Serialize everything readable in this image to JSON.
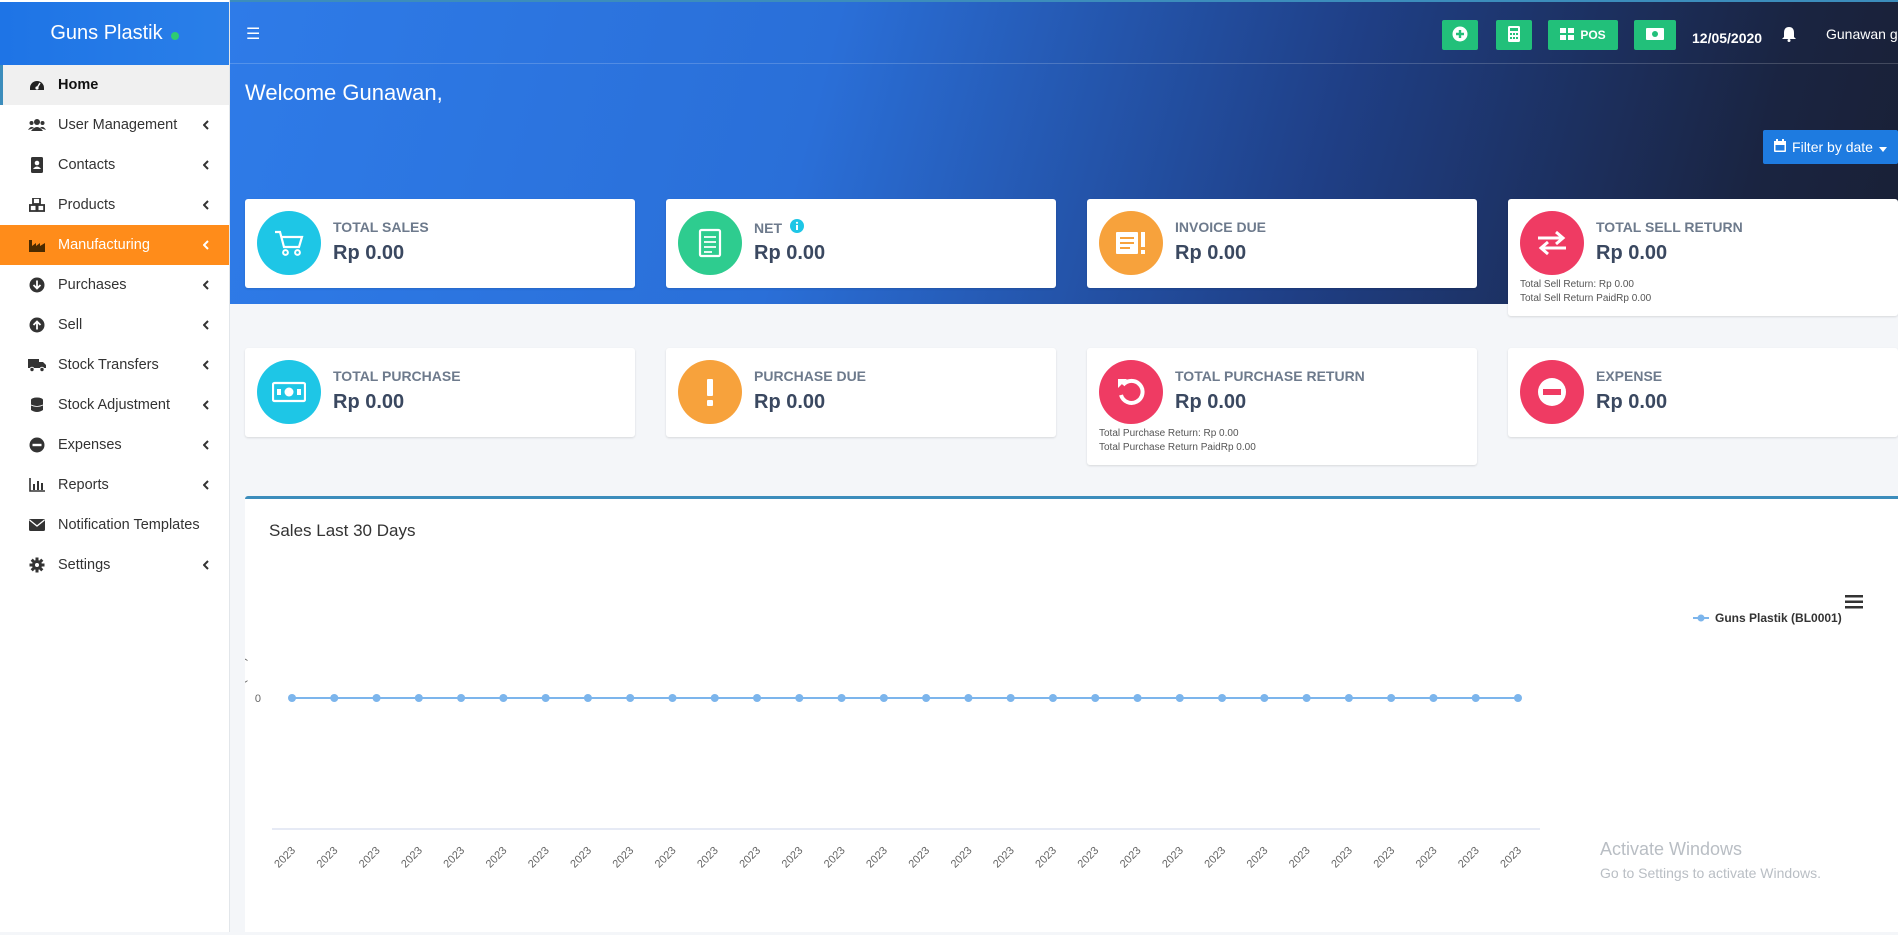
{
  "brand": {
    "name": "Guns Plastik"
  },
  "sidebar": {
    "items": [
      {
        "label": "Home",
        "icon": "dashboard-icon"
      },
      {
        "label": "User Management",
        "icon": "users-icon"
      },
      {
        "label": "Contacts",
        "icon": "address-book-icon"
      },
      {
        "label": "Products",
        "icon": "cubes-icon"
      },
      {
        "label": "Manufacturing",
        "icon": "industry-icon"
      },
      {
        "label": "Purchases",
        "icon": "arrow-circle-down-icon"
      },
      {
        "label": "Sell",
        "icon": "arrow-circle-up-icon"
      },
      {
        "label": "Stock Transfers",
        "icon": "truck-icon"
      },
      {
        "label": "Stock Adjustment",
        "icon": "database-icon"
      },
      {
        "label": "Expenses",
        "icon": "minus-circle-icon"
      },
      {
        "label": "Reports",
        "icon": "bar-chart-icon"
      },
      {
        "label": "Notification Templates",
        "icon": "envelope-icon"
      },
      {
        "label": "Settings",
        "icon": "gear-icon"
      }
    ]
  },
  "header": {
    "pos_label": "POS",
    "date": "12/05/2020",
    "user": "Gunawan g"
  },
  "welcome": "Welcome Gunawan,",
  "filter_label": "Filter by date",
  "cards": {
    "total_sales": {
      "title": "TOTAL SALES",
      "value": "Rp 0.00"
    },
    "net": {
      "title": "NET",
      "value": "Rp 0.00"
    },
    "invoice_due": {
      "title": "INVOICE DUE",
      "value": "Rp 0.00"
    },
    "total_sell_return": {
      "title": "TOTAL SELL RETURN",
      "value": "Rp 0.00",
      "line1": "Total Sell Return: Rp 0.00",
      "line2": "Total Sell Return PaidRp 0.00"
    },
    "total_purchase": {
      "title": "TOTAL PURCHASE",
      "value": "Rp 0.00"
    },
    "purchase_due": {
      "title": "PURCHASE DUE",
      "value": "Rp 0.00"
    },
    "total_purchase_return": {
      "title": "TOTAL PURCHASE RETURN",
      "value": "Rp 0.00",
      "line1": "Total Purchase Return: Rp 0.00",
      "line2": "Total Purchase Return PaidRp 0.00"
    },
    "expense": {
      "title": "EXPENSE",
      "value": "Rp 0.00"
    }
  },
  "colors": {
    "cyan": "#1ec6e6",
    "green": "#2ecc8f",
    "orange": "#f7a23c",
    "red": "#ef3b63",
    "accent": "#1e7be0"
  },
  "chart_panel": {
    "title": "Sales Last 30 Days"
  },
  "watermark": {
    "line1": "Activate Windows",
    "line2": "Go to Settings to activate Windows."
  },
  "chart_data": {
    "type": "line",
    "ylabel": "Total Sales (IDR)",
    "y_ticks": [
      "0"
    ],
    "categories": [
      "2023",
      "2023",
      "2023",
      "2023",
      "2023",
      "2023",
      "2023",
      "2023",
      "2023",
      "2023",
      "2023",
      "2023",
      "2023",
      "2023",
      "2023",
      "2023",
      "2023",
      "2023",
      "2023",
      "2023",
      "2023",
      "2023",
      "2023",
      "2023",
      "2023",
      "2023",
      "2023",
      "2023",
      "2023",
      "2023"
    ],
    "series": [
      {
        "name": "Guns Plastik (BL0001)",
        "values": [
          0,
          0,
          0,
          0,
          0,
          0,
          0,
          0,
          0,
          0,
          0,
          0,
          0,
          0,
          0,
          0,
          0,
          0,
          0,
          0,
          0,
          0,
          0,
          0,
          0,
          0,
          0,
          0,
          0,
          0
        ],
        "color": "#7cb5ec"
      }
    ],
    "legend": "top-right",
    "grid": false
  }
}
